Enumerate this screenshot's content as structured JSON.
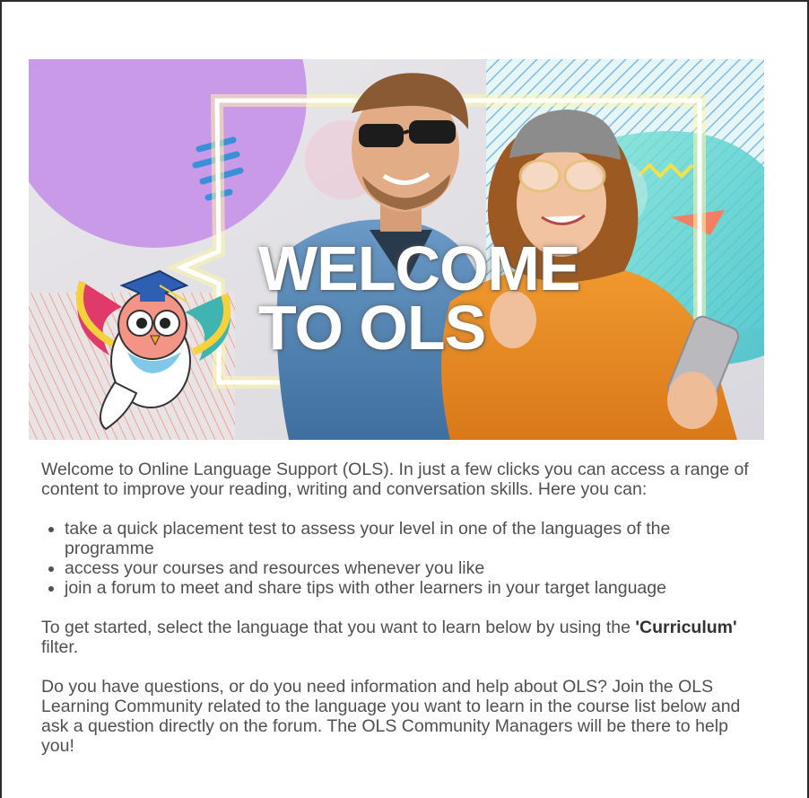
{
  "banner": {
    "title_line1": "WELCOME",
    "title_line2": "TO OLS",
    "colors": {
      "purple": "#c99ae8",
      "teal": "#5cd6c8",
      "orange": "#e58a1f",
      "salmon": "#f27f64",
      "blue": "#3b8fd9",
      "yellow": "#f5e04a"
    }
  },
  "content": {
    "intro": "Welcome to Online Language Support (OLS). In just a few clicks you can access a range of content to improve your reading, writing and conversation skills. Here you can:",
    "bullets": [
      "take a quick placement test to assess your level in one of the languages of the programme",
      "access your courses and resources whenever you like",
      "join a forum to meet and share tips with other learners in your target language"
    ],
    "getting_started_prefix": "To get started, select the language that you want to learn below by using the ",
    "getting_started_bold": "'Curriculum'",
    "getting_started_suffix": " filter.",
    "help": "Do you have questions, or do you need information and help about OLS? Join the OLS Learning Community related to the language you want to learn in the course list below and ask a question directly on the forum. The OLS Community Managers will be there to help you!"
  }
}
